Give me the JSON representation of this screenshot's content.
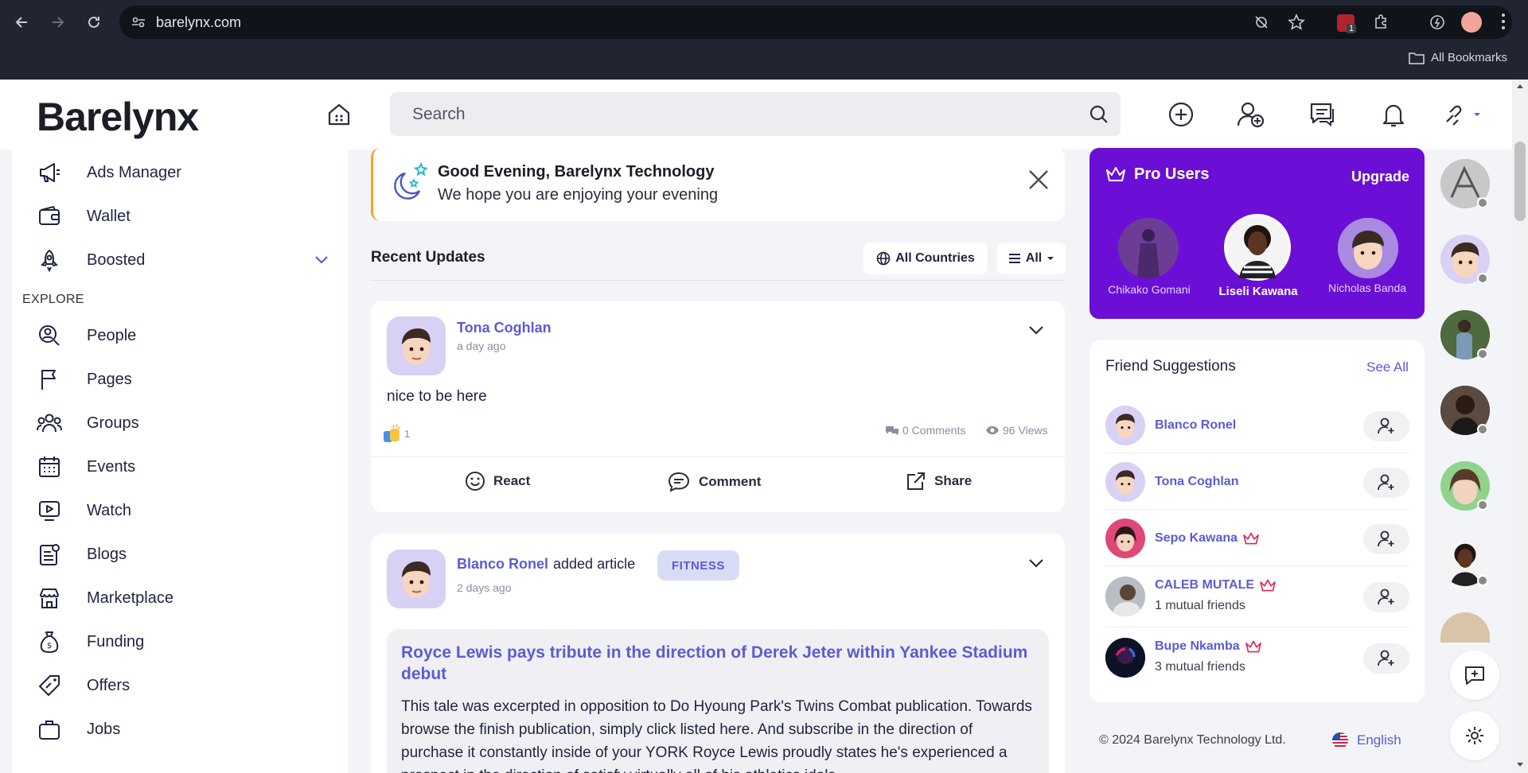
{
  "browser": {
    "url": "barelynx.com",
    "bookmarks_label": "All Bookmarks",
    "extension_badge": "1"
  },
  "header": {
    "logo": "Barelynx",
    "search_placeholder": "Search"
  },
  "sidebar": {
    "items_top": [
      {
        "label": "Ads Manager",
        "icon": "megaphone-icon"
      },
      {
        "label": "Wallet",
        "icon": "wallet-icon"
      },
      {
        "label": "Boosted",
        "icon": "rocket-icon"
      }
    ],
    "section_explore": "EXPLORE",
    "items_explore": [
      {
        "label": "People",
        "icon": "people-search-icon"
      },
      {
        "label": "Pages",
        "icon": "flag-icon"
      },
      {
        "label": "Groups",
        "icon": "groups-icon"
      },
      {
        "label": "Events",
        "icon": "calendar-icon"
      },
      {
        "label": "Watch",
        "icon": "play-icon"
      },
      {
        "label": "Blogs",
        "icon": "blog-icon"
      },
      {
        "label": "Marketplace",
        "icon": "store-icon"
      },
      {
        "label": "Funding",
        "icon": "money-bag-icon"
      },
      {
        "label": "Offers",
        "icon": "offer-tag-icon"
      },
      {
        "label": "Jobs",
        "icon": "briefcase-icon"
      }
    ]
  },
  "greeting": {
    "title": "Good Evening, Barelynx Technology",
    "subtitle": "We hope you are enjoying your evening"
  },
  "feed": {
    "heading": "Recent Updates",
    "filter_country": "All Countries",
    "filter_type": "All",
    "posts": [
      {
        "author": "Tona Coghlan",
        "time": "a day ago",
        "text": "nice to be here",
        "reactions": "1",
        "comments": "0 Comments",
        "views": "96 Views",
        "actions": {
          "react": "React",
          "comment": "Comment",
          "share": "Share"
        }
      },
      {
        "author": "Blanco Ronel",
        "verb": "added article",
        "tag": "FITNESS",
        "time": "2 days ago",
        "article_title": "Royce Lewis pays tribute in the direction of Derek Jeter within Yankee Stadium debut",
        "article_body": "This tale was excerpted in opposition to Do Hyoung Park's Twins Combat publication. Towards browse the finish publication, simply click listed here. And subscribe in the direction of purchase it constantly inside of your YORK Royce Lewis proudly states he's experienced a prospect in the direction of satisfy virtually all of his athletics idols"
      }
    ]
  },
  "pro_users": {
    "title": "Pro Users",
    "upgrade": "Upgrade",
    "users": [
      "Chikako Gomani",
      "Liseli Kawana",
      "Nicholas Banda"
    ]
  },
  "friend_suggestions": {
    "title": "Friend Suggestions",
    "see_all": "See All",
    "people": [
      {
        "name": "Blanco Ronel",
        "sub": "",
        "pro": false
      },
      {
        "name": "Tona Coghlan",
        "sub": "",
        "pro": false
      },
      {
        "name": "Sepo Kawana",
        "sub": "",
        "pro": true
      },
      {
        "name": "CALEB MUTALE",
        "sub": "1 mutual friends",
        "pro": true
      },
      {
        "name": "Bupe Nkamba",
        "sub": "3 mutual friends",
        "pro": true
      }
    ]
  },
  "footer": {
    "copyright": "© 2024 Barelynx Technology Ltd.",
    "language": "English"
  },
  "colors": {
    "brand": "#6b0fd6",
    "link": "#5b5bd6",
    "pro_crown": "#e0245e"
  }
}
